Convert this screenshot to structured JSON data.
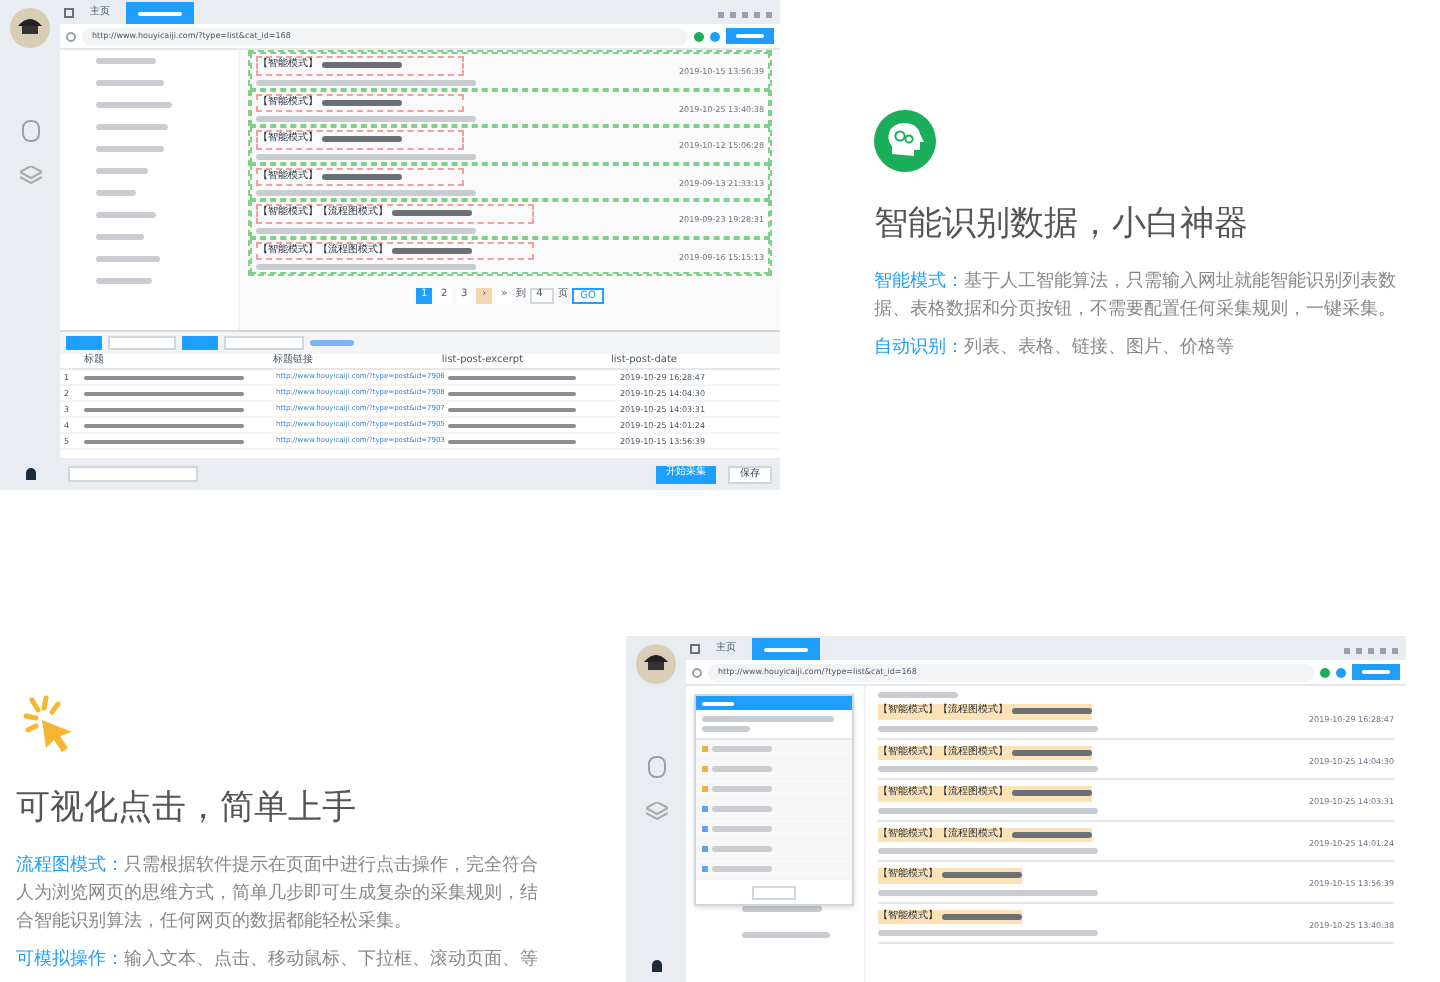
{
  "app_top": {
    "tabs": [
      {
        "label": "主页",
        "selected": false
      },
      {
        "selected": true
      }
    ],
    "url": "http://www.houyicaiji.com/?type=list&cat_id=168",
    "entries": [
      {
        "tags": [
          "【智能模式】"
        ],
        "date": "2019-10-15 13:56:39"
      },
      {
        "tags": [
          "【智能模式】"
        ],
        "date": "2019-10-25 13:40:38"
      },
      {
        "tags": [
          "【智能模式】"
        ],
        "date": "2019-10-12 15:06:28"
      },
      {
        "tags": [
          "【智能模式】"
        ],
        "date": "2019-09-13 21:33:13"
      },
      {
        "tags": [
          "【智能模式】",
          "【流程图模式】"
        ],
        "date": "2019-09-23 19:28:31"
      },
      {
        "tags": [
          "【智能模式】",
          "【流程图模式】"
        ],
        "date": "2019-09-16 15:15:13"
      }
    ],
    "pages": [
      {
        "label": "1",
        "selected": true
      },
      {
        "label": "2",
        "selected": false
      },
      {
        "label": "3",
        "selected": false
      },
      {
        "label": "›",
        "selected": false
      },
      {
        "label": "»",
        "selected": false
      }
    ],
    "goto": {
      "before": "到",
      "value": "4",
      "after": "页",
      "button": "GO"
    },
    "table": {
      "columns": [
        "标题",
        "标题链接",
        "list-post-excerpt",
        "list-post-date"
      ],
      "rows": [
        {
          "index": "1",
          "link": "http://www.houyicaiji.com/?type=post&id=7906",
          "date": "2019-10-29 16:28:47"
        },
        {
          "index": "2",
          "link": "http://www.houyicaiji.com/?type=post&id=7908",
          "date": "2019-10-25 14:04:30"
        },
        {
          "index": "3",
          "link": "http://www.houyicaiji.com/?type=post&id=7907",
          "date": "2019-10-25 14:03:31"
        },
        {
          "index": "4",
          "link": "http://www.houyicaiji.com/?type=post&id=7905",
          "date": "2019-10-25 14:01:24"
        },
        {
          "index": "5",
          "link": "http://www.houyicaiji.com/?type=post&id=7903",
          "date": "2019-10-15 13:56:39"
        }
      ]
    },
    "footer_buttons": [
      {
        "label": "开始采集",
        "kind": "primary"
      },
      {
        "label": "保存",
        "kind": "plain"
      }
    ]
  },
  "feature_top": {
    "title": "智能识别数据，小白神器",
    "paragraphs": [
      {
        "label": "智能模式：",
        "text": "基于人工智能算法，只需输入网址就能智能识别列表数据、表格数据和分页按钮，不需要配置任何采集规则，一键采集。"
      },
      {
        "label": "自动识别：",
        "text": "列表、表格、链接、图片、价格等"
      }
    ]
  },
  "feature_bottom": {
    "title": "可视化点击，简单上手",
    "paragraphs": [
      {
        "label": "流程图模式：",
        "text": "只需根据软件提示在页面中进行点击操作，完全符合人为浏览网页的思维方式，简单几步即可生成复杂的采集规则，结合智能识别算法，任何网页的数据都能轻松采集。"
      },
      {
        "label": "可模拟操作：",
        "text": "输入文本、点击、移动鼠标、下拉框、滚动页面、等"
      }
    ]
  },
  "app_bottom": {
    "tabs": [
      {
        "label": "主页",
        "selected": false
      },
      {
        "selected": true
      }
    ],
    "url": "http://www.houyicaiji.com/?type=list&cat_id=168",
    "entries": [
      {
        "tags": [
          "【智能模式】",
          "【流程图模式】"
        ],
        "date": "2019-10-29 16:28:47"
      },
      {
        "tags": [
          "【智能模式】",
          "【流程图模式】"
        ],
        "date": "2019-10-25 14:04:30"
      },
      {
        "tags": [
          "【智能模式】",
          "【流程图模式】"
        ],
        "date": "2019-10-25 14:03:31"
      },
      {
        "tags": [
          "【智能模式】",
          "【流程图模式】"
        ],
        "date": "2019-10-25 14:01:24"
      },
      {
        "tags": [
          "【智能模式】"
        ],
        "date": "2019-10-15 13:56:39"
      },
      {
        "tags": [
          "【智能模式】"
        ],
        "date": "2019-10-25 13:40:38"
      }
    ]
  }
}
